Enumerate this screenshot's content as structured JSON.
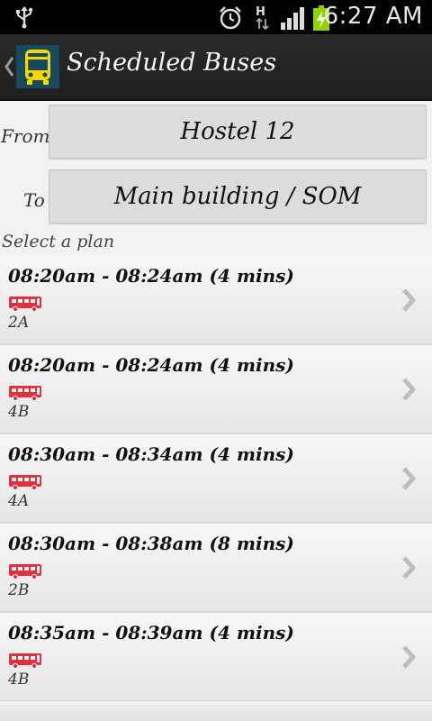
{
  "status_bar": {
    "time": "6:27 AM",
    "network_letter": "H"
  },
  "action_bar": {
    "title": "Scheduled Buses"
  },
  "form": {
    "from_label": "From",
    "from_value": "Hostel 12",
    "to_label": "To",
    "to_value": "Main building / SOM"
  },
  "section_title": "Select a plan",
  "plans": [
    {
      "time": "08:20am - 08:24am (4 mins)",
      "route": "2A"
    },
    {
      "time": "08:20am - 08:24am (4 mins)",
      "route": "4B"
    },
    {
      "time": "08:30am - 08:34am (4 mins)",
      "route": "4A"
    },
    {
      "time": "08:30am - 08:38am (8 mins)",
      "route": "2B"
    },
    {
      "time": "08:35am - 08:39am (4 mins)",
      "route": "4B"
    }
  ],
  "colors": {
    "bus_icon": "#e0313c",
    "logo_bg": "#174a5e",
    "logo_bus": "#f5d800"
  }
}
